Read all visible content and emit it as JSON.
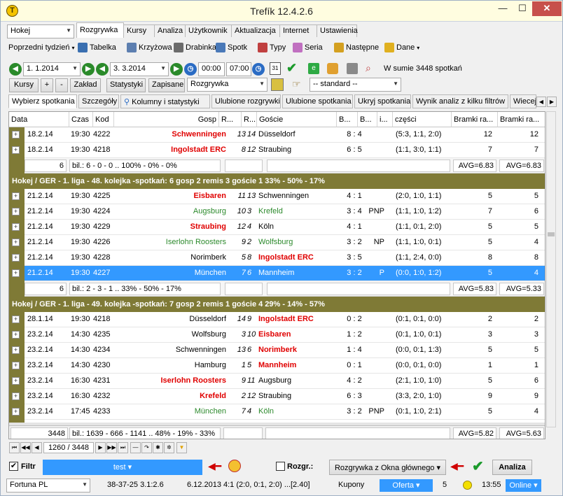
{
  "window": {
    "title": "Trefík 12.4.2.6",
    "min_label": "—",
    "max_label": "☐",
    "close_label": "✕"
  },
  "sport": {
    "value": "Hokej"
  },
  "period": {
    "label": "Poprzedni tydzień"
  },
  "tabs": [
    "Rozgrywka",
    "Kursy",
    "Analiza",
    "Użytkownik",
    "Aktualizacja",
    "Internet",
    "Ustawienia"
  ],
  "toolbar": [
    {
      "label": "Tabelka",
      "color": "#3a6fb0"
    },
    {
      "label": "Krzyżowa",
      "color": "#5d7fb0"
    },
    {
      "label": "Drabinka",
      "color": "#6b6b6b"
    },
    {
      "label": "Spotk",
      "color": "#4a79b8"
    },
    {
      "label": "Typy",
      "color": "#c04040"
    },
    {
      "label": "Seria",
      "color": "#c070c0"
    },
    {
      "label": "Następne",
      "color": "#d4a020"
    },
    {
      "label": "Dane",
      "color": "#e0b020"
    }
  ],
  "filter_row": {
    "date_from": "1.  1.2014",
    "date_to": "3.  3.2014",
    "time_from": "00:00",
    "time_to": "07:00",
    "total": "W sumie 3448 spotkań"
  },
  "buttons_row": {
    "kursy": "Kursy",
    "plus": "+",
    "minus": "-",
    "zaklad": "Zakład",
    "statystyki": "Statystyki",
    "zapisane": "Zapisane",
    "rozgrywka_select": "Rozgrywka",
    "standard_select": "-- standard --"
  },
  "subtabs": [
    "Wybierz spotkania",
    "Szczegóły",
    "Kolumny i statystyki",
    "Ulubione rozgrywki",
    "Ulubione spotkania",
    "Ukryj spotkania",
    "Wynik analiz z kilku filtrów",
    "Wiecej"
  ],
  "columns": [
    "Data",
    "Czas",
    "Kod",
    "Gosp",
    "R...",
    "R...",
    "Goście",
    "B...",
    "B...",
    "i...",
    "części",
    "Bramki ra...",
    "Bramki ra..."
  ],
  "block0_rows": [
    {
      "date": "18.2.14",
      "time": "19:30",
      "code": "4222",
      "home": "Schwenningen",
      "home_style": "red",
      "r1": "13",
      "r2": "14",
      "away": "Düsseldorf",
      "away_style": "",
      "score": "8 : 4",
      "flag": "",
      "note": "",
      "parts": "(5:3, 1:1, 2:0)",
      "g1": "12",
      "g2": "12"
    },
    {
      "date": "18.2.14",
      "time": "19:30",
      "code": "4218",
      "home": "Ingolstadt ERC",
      "home_style": "red",
      "r1": "8",
      "r2": "12",
      "away": "Straubing",
      "away_style": "",
      "score": "6 : 5",
      "flag": "",
      "note": "",
      "parts": "(1:1, 3:0, 1:1)",
      "g1": "7",
      "g2": "7"
    }
  ],
  "block0_summary": {
    "count": "6",
    "bil": "bil.: 6 - 0 - 0 .. 100% - 0% - 0%",
    "avg1": "AVG=6.83",
    "avg2": "AVG=6.83"
  },
  "group1": {
    "title": "Hokej / GER - 1. liga - 48. kolejka -spotkań: 6  gosp 2  remis 3  goście 1     33% - 50% - 17%"
  },
  "block1_rows": [
    {
      "date": "21.2.14",
      "time": "19:30",
      "code": "4225",
      "home": "Eisbaren",
      "home_style": "red",
      "r1": "11",
      "r2": "13",
      "away": "Schwenningen",
      "away_style": "",
      "score": "4 : 1",
      "flag": "",
      "note": "",
      "parts": "(2:0, 1:0, 1:1)",
      "g1": "5",
      "g2": "5"
    },
    {
      "date": "21.2.14",
      "time": "19:30",
      "code": "4224",
      "home": "Augsburg",
      "home_style": "grn",
      "r1": "10",
      "r2": "3",
      "away": "Krefeld",
      "away_style": "grn",
      "score": "3 : 4",
      "flag": "PNP",
      "note": "",
      "parts": "(1:1, 1:0, 1:2)",
      "g1": "7",
      "g2": "6"
    },
    {
      "date": "21.2.14",
      "time": "19:30",
      "code": "4229",
      "home": "Straubing",
      "home_style": "red",
      "r1": "12",
      "r2": "4",
      "away": "Köln",
      "away_style": "",
      "score": "4 : 1",
      "flag": "",
      "note": "",
      "parts": "(1:1, 0:1, 2:0)",
      "g1": "5",
      "g2": "5"
    },
    {
      "date": "21.2.14",
      "time": "19:30",
      "code": "4226",
      "home": "Iserlohn Roosters",
      "home_style": "grn",
      "r1": "9",
      "r2": "2",
      "away": "Wolfsburg",
      "away_style": "grn",
      "score": "3 : 2",
      "flag": "NP",
      "note": "",
      "parts": "(1:1, 1:0, 0:1)",
      "g1": "5",
      "g2": "4"
    },
    {
      "date": "21.2.14",
      "time": "19:30",
      "code": "4228",
      "home": "Norimberk",
      "home_style": "",
      "r1": "5",
      "r2": "8",
      "away": "Ingolstadt ERC",
      "away_style": "red",
      "score": "3 : 5",
      "flag": "",
      "note": "",
      "parts": "(1:1, 2:4, 0:0)",
      "g1": "8",
      "g2": "8"
    },
    {
      "date": "21.2.14",
      "time": "19:30",
      "code": "4227",
      "home": "München",
      "home_style": "",
      "r1": "7",
      "r2": "6",
      "away": "Mannheim",
      "away_style": "",
      "score": "3 : 2",
      "flag": "P",
      "note": "",
      "parts": "(0:0, 1:0, 1:2)",
      "g1": "5",
      "g2": "4",
      "selected": true
    }
  ],
  "block1_summary": {
    "count": "6",
    "bil": "bil.: 2 - 3 - 1 .. 33% - 50% - 17%",
    "avg1": "AVG=5.83",
    "avg2": "AVG=5.33"
  },
  "group2": {
    "title": "Hokej / GER - 1. liga - 49. kolejka -spotkań: 7  gosp 2  remis 1  goście 4     29% - 14% - 57%"
  },
  "block2_rows": [
    {
      "date": "28.1.14",
      "time": "19:30",
      "code": "4218",
      "home": "Düsseldorf",
      "home_style": "",
      "r1": "14",
      "r2": "9",
      "away": "Ingolstadt ERC",
      "away_style": "red",
      "score": "0 : 2",
      "flag": "",
      "note": "",
      "parts": "(0:1, 0:1, 0:0)",
      "g1": "2",
      "g2": "2"
    },
    {
      "date": "23.2.14",
      "time": "14:30",
      "code": "4235",
      "home": "Wolfsburg",
      "home_style": "",
      "r1": "3",
      "r2": "10",
      "away": "Eisbaren",
      "away_style": "red",
      "score": "1 : 2",
      "flag": "",
      "note": "",
      "parts": "(0:1, 1:0, 0:1)",
      "g1": "3",
      "g2": "3"
    },
    {
      "date": "23.2.14",
      "time": "14:30",
      "code": "4234",
      "home": "Schwenningen",
      "home_style": "",
      "r1": "13",
      "r2": "6",
      "away": "Norimberk",
      "away_style": "red",
      "score": "1 : 4",
      "flag": "",
      "note": "",
      "parts": "(0:0, 0:1, 1:3)",
      "g1": "5",
      "g2": "5"
    },
    {
      "date": "23.2.14",
      "time": "14:30",
      "code": "4230",
      "home": "Hamburg",
      "home_style": "",
      "r1": "1",
      "r2": "5",
      "away": "Mannheim",
      "away_style": "red",
      "score": "0 : 1",
      "flag": "",
      "note": "",
      "parts": "(0:0, 0:1, 0:0)",
      "g1": "1",
      "g2": "1"
    },
    {
      "date": "23.2.14",
      "time": "16:30",
      "code": "4231",
      "home": "Iserlohn Roosters",
      "home_style": "red",
      "r1": "9",
      "r2": "11",
      "away": "Augsburg",
      "away_style": "",
      "score": "4 : 2",
      "flag": "",
      "note": "",
      "parts": "(2:1, 1:0, 1:0)",
      "g1": "5",
      "g2": "6"
    },
    {
      "date": "23.2.14",
      "time": "16:30",
      "code": "4232",
      "home": "Krefeld",
      "home_style": "red",
      "r1": "2",
      "r2": "12",
      "away": "Straubing",
      "away_style": "",
      "score": "6 : 3",
      "flag": "",
      "note": "",
      "parts": "(3:3, 2:0, 1:0)",
      "g1": "9",
      "g2": "9"
    },
    {
      "date": "23.2.14",
      "time": "17:45",
      "code": "4233",
      "home": "München",
      "home_style": "grn",
      "r1": "7",
      "r2": "4",
      "away": "Köln",
      "away_style": "grn",
      "score": "3 : 2",
      "flag": "PNP",
      "note": "",
      "parts": "(0:1, 1:0, 2:1)",
      "g1": "5",
      "g2": "4"
    }
  ],
  "grid_summary": {
    "count": "3448",
    "bil": "bil.: 1639 - 666 - 1141 .. 48% - 19% - 33%",
    "avg1": "AVG=5.82",
    "avg2": "AVG=5.63"
  },
  "navigator": {
    "position": "1260 / 3448"
  },
  "bottom": {
    "filtr": "Filtr",
    "filter_name": "test",
    "rozgr": "Rozgr.:",
    "rozgr_select": "Rozgrywka z Okna głównego",
    "analiza": "Analiza"
  },
  "statusbar": {
    "bookmaker": "Fortuna PL",
    "record": "38-37-25  3.1:2.6",
    "last": "6.12.2013 4:1 (2:0, 0:1, 2:0) ...[2.40]",
    "kupony": "Kupony",
    "oferta": "Oferta",
    "count": "5",
    "clock": "13:55",
    "online": "Online"
  }
}
